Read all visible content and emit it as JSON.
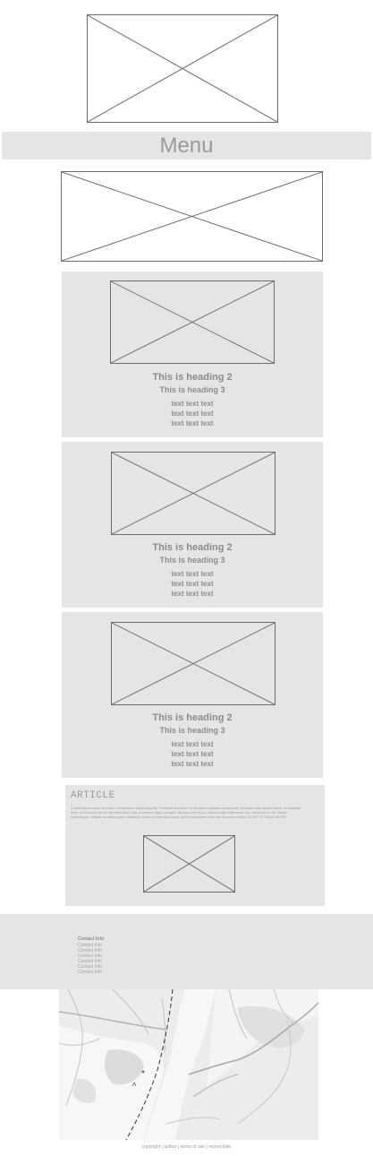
{
  "menu": {
    "label": "Menu"
  },
  "cards": [
    {
      "heading2": "This is heading 2",
      "heading3": "This is heading 3",
      "lines": [
        "text text text",
        "text text text",
        "text text text"
      ]
    },
    {
      "heading2": "This is heading 2",
      "heading3": "This is heading 3",
      "lines": [
        "text text text",
        "text text text",
        "text text text"
      ]
    },
    {
      "heading2": "This is heading 2",
      "heading3": "This is heading 3",
      "lines": [
        "text text text",
        "text text text",
        "text text text"
      ]
    }
  ],
  "article": {
    "title": "ARTICLE",
    "body": "Lorem ipsum dolor sit amet, consectetur adipiscing elit. Praesent tincidunt mi vel tellus sodales consequat. Quisque vitae ipsum lacus, ut molestie ante. Ut rhoncus nisl in nisl bibendum non commodo ligula semper. Aenean sed nunc, ultrices eget bibendum nec, tincidunt ut nisi. Etiam scelerisque, mauris ac ullamcorper tincidunt, tellus mi interdum justo, quis consectetur odio nisl sit amet metus. CLICK TO READ MORE"
  },
  "footer": {
    "title": "Contact Info",
    "items": [
      "Contact Info",
      "Contact Info",
      "Contact Info",
      "Contact Info",
      "Contact Info",
      "Contact Info"
    ]
  },
  "copyright": "copyright | author | terms of use | recent date"
}
